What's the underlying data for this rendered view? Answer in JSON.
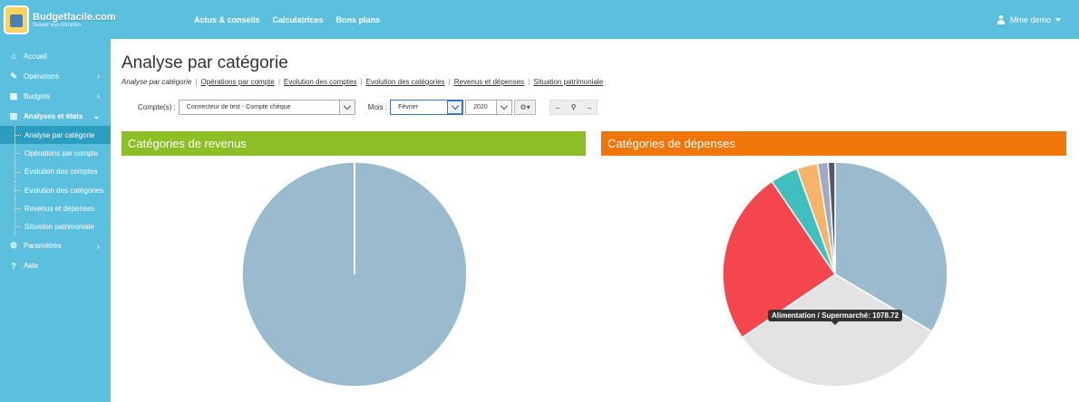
{
  "app": {
    "logo_name": "Budgetfacile.com",
    "logo_tagline": "Suivez vos comptes"
  },
  "topnav": {
    "items": [
      "Actus & conseils",
      "Calculatrices",
      "Bons plans"
    ]
  },
  "user": {
    "name": "Mme demo"
  },
  "sidebar": {
    "items": [
      {
        "label": "Accueil",
        "icon": "home-icon"
      },
      {
        "label": "Opérations",
        "icon": "pencil-icon"
      },
      {
        "label": "Budgets",
        "icon": "calendar-icon"
      },
      {
        "label": "Analyses et états",
        "icon": "bar-chart-icon"
      }
    ],
    "subitems": [
      "Analyse par catégorie",
      "Opérations par compte",
      "Evolution des comptes",
      "Evolution des catégories",
      "Revenus et dépenses",
      "Situation patrimoniale"
    ],
    "active_subitem": "Analyse par catégorie",
    "after_items": [
      {
        "label": "Paramètres",
        "icon": "cogs-icon"
      },
      {
        "label": "Aide",
        "icon": "question-icon"
      }
    ]
  },
  "page": {
    "title": "Analyse par catégorie",
    "breadcrumb": {
      "current": "Analyse par catégorie",
      "links": [
        "Opérations par compte",
        "Evolution des comptes",
        "Evolution des catégories",
        "Revenus et dépenses",
        "Situation patrimoniale"
      ]
    }
  },
  "filters": {
    "comptes_label": "Compte(s) :",
    "comptes_value": "Connecteur de test - Compte chèque",
    "mois_label": "Mois :",
    "mois_value": "Février",
    "annee_value": "2020"
  },
  "panels": {
    "revenus_title": "Catégories de revenus",
    "depenses_title": "Catégories de dépenses"
  },
  "tooltip": {
    "text": "Alimentation / Supermarché: 1078.72"
  },
  "colors": {
    "brand": "#5bc0de",
    "active_nav": "#2b9ebf",
    "revenus": "#8cbf26",
    "depenses": "#f0760a"
  },
  "chart_data": [
    {
      "type": "pie",
      "title": "Catégories de revenus",
      "slices": [
        {
          "value": 100,
          "color": "#99bbcd"
        }
      ]
    },
    {
      "type": "pie",
      "title": "Catégories de dépenses",
      "slices": [
        {
          "value": 33.5,
          "color": "#99bbcd"
        },
        {
          "value": 32,
          "color": "#e3e3e3",
          "label": "Alimentation / Supermarché",
          "amount": 1078.72
        },
        {
          "value": 25,
          "color": "#f5454d"
        },
        {
          "value": 4,
          "color": "#41bfbf"
        },
        {
          "value": 3,
          "color": "#f7b469"
        },
        {
          "value": 1.5,
          "color": "#a0a8c8"
        },
        {
          "value": 1,
          "color": "#505a64"
        }
      ]
    }
  ]
}
